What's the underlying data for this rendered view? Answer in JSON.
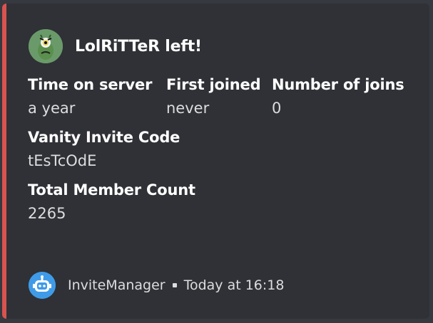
{
  "author": {
    "name": "LolRiTTeR left!",
    "avatar_icon": "plankton-avatar-icon"
  },
  "fields_row1": [
    {
      "name": "Time on server",
      "value": "a year"
    },
    {
      "name": "First joined",
      "value": "never"
    },
    {
      "name": "Number of joins",
      "value": "0"
    }
  ],
  "vanity": {
    "name": "Vanity Invite Code",
    "value": "tEsTcOdE"
  },
  "members": {
    "name": "Total Member Count",
    "value": "2265"
  },
  "footer": {
    "bot_name": "InviteManager",
    "timestamp": "Today at 16:18",
    "bot_icon": "bot-avatar-icon"
  },
  "colors": {
    "accent": "#d9534f",
    "embed_bg": "#2f3136",
    "page_bg": "#36393f"
  }
}
